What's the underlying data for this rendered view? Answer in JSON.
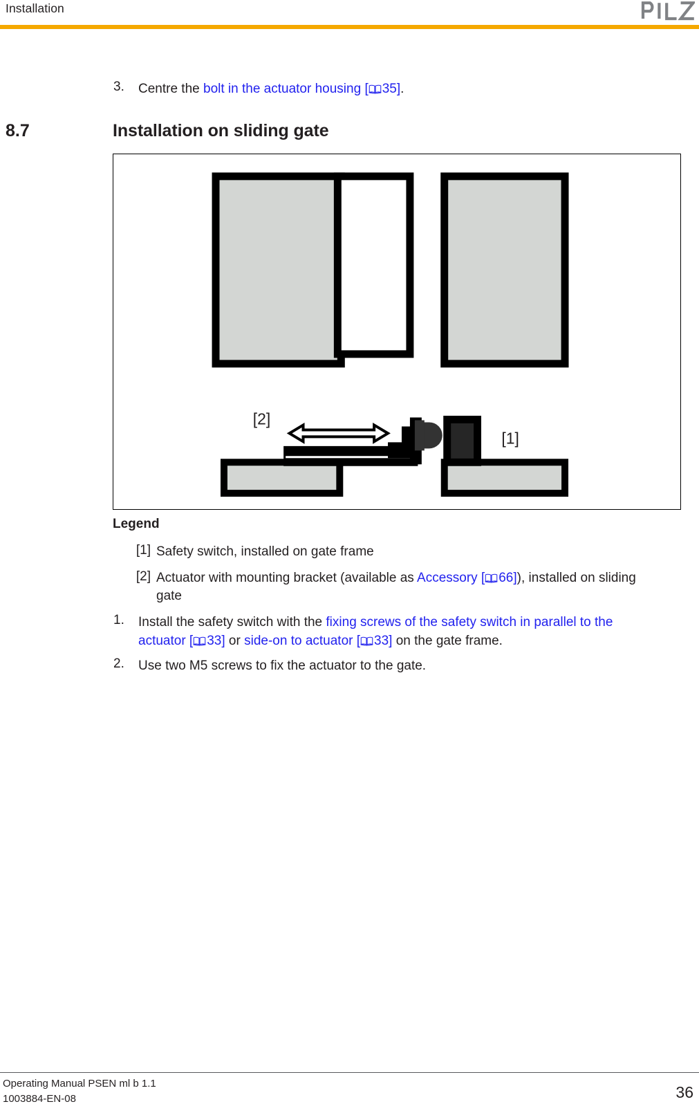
{
  "header": {
    "chapter_title": "Installation",
    "logo_text": "PILZ",
    "rule_color": "#f5a800"
  },
  "top_step": {
    "number": "3.",
    "text_before": "Centre the ",
    "link_text": "bolt in the actuator housing",
    "xref_open": " [",
    "xref_icon": "book-icon",
    "xref_page": "35",
    "xref_close": "]",
    "text_after": "."
  },
  "section": {
    "number": "8.7",
    "title": "Installation on sliding gate"
  },
  "figure": {
    "caption_labels": {
      "label_1": "[1]",
      "label_2": "[2]"
    },
    "colors": {
      "fill_gray": "#d3d6d3",
      "outline": "#000000",
      "switch_body": "#262626",
      "nub": "#333333"
    }
  },
  "legend": {
    "title": "Legend",
    "items": [
      {
        "tag": "[1]",
        "text": "Safety switch, installed on gate frame"
      },
      {
        "tag": "[2]",
        "text_before": "Actuator with mounting bracket (available as ",
        "link_text": "Accessory",
        "xref_open": " [",
        "xref_page": "66",
        "xref_close": "]",
        "text_after": "), installed on sliding gate"
      }
    ]
  },
  "steps": [
    {
      "number": "1.",
      "text_before": "Install the safety switch with the ",
      "link_text_1": "fixing screws of the safety switch in parallel to the actuator",
      "xref_1_open": " [",
      "xref_1_page": "33",
      "xref_1_close": "]",
      "text_middle": " or ",
      "link_text_2": "side-on to actuator",
      "xref_2_open": " [",
      "xref_2_page": "33",
      "xref_2_close": "]",
      "text_after": " on the gate frame."
    },
    {
      "number": "2.",
      "text": "Use two M5 screws to fix the actuator to the gate."
    }
  ],
  "footer": {
    "line1": "Operating Manual PSEN ml b 1.1",
    "line2": "1003884-EN-08",
    "page_number": "36"
  }
}
